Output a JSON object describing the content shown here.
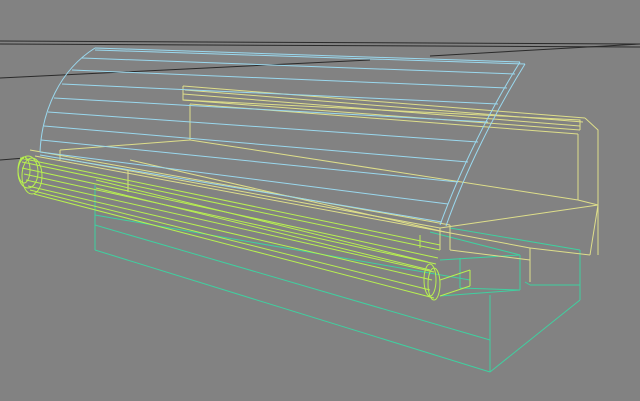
{
  "viewport": {
    "background_color": "#828282",
    "line_colors": {
      "grid": "#2a2a2a",
      "glass_canopy": "#9ad8ee",
      "rear_shelf_and_body": "#dede8a",
      "front_rail": "#b8f050",
      "base_cabinet": "#3fd0a0"
    }
  }
}
